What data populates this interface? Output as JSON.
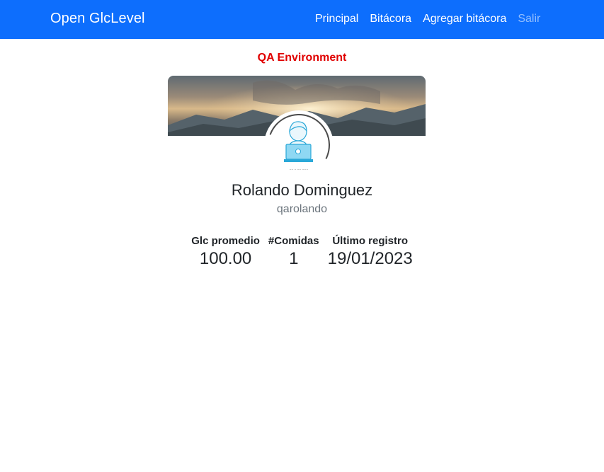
{
  "navbar": {
    "brand": "Open GlcLevel",
    "links": [
      {
        "label": "Principal"
      },
      {
        "label": "Bitácora"
      },
      {
        "label": "Agregar bitácora"
      },
      {
        "label": "Salir"
      }
    ],
    "color": "#0d6efd"
  },
  "environment_label": "QA Environment",
  "environment_color": "#e00000",
  "profile": {
    "name": "Rolando Dominguez",
    "username": "qarolando",
    "avatar_icon": "user-laptop-icon",
    "banner_image": "mountain-sunset-banner"
  },
  "stats": [
    {
      "label": "Glc promedio",
      "value": "100.00"
    },
    {
      "label": "#Comidas",
      "value": "1"
    },
    {
      "label": "Último registro",
      "value": "19/01/2023"
    }
  ]
}
